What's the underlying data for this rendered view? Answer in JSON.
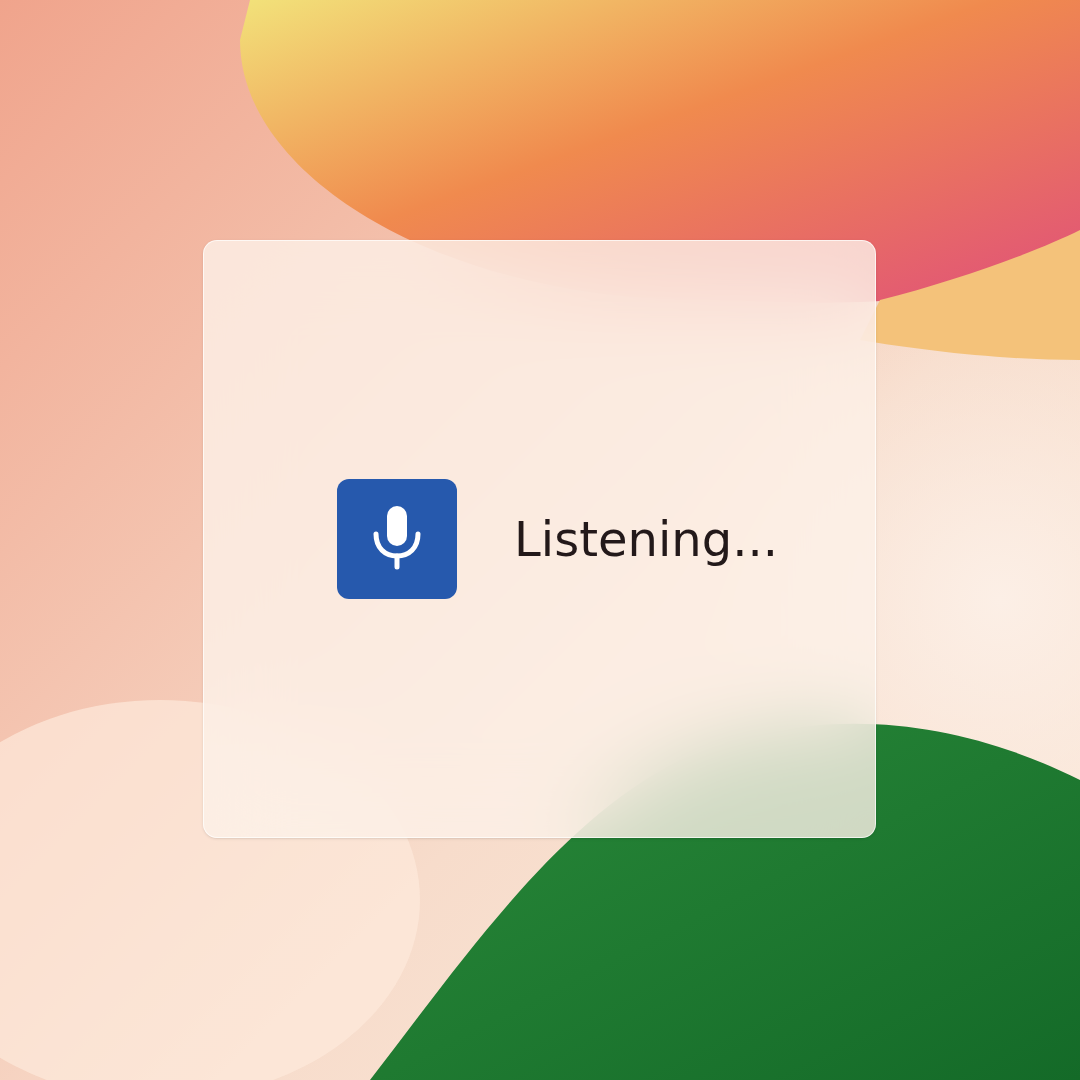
{
  "prompt": {
    "text": "Listening..."
  }
}
